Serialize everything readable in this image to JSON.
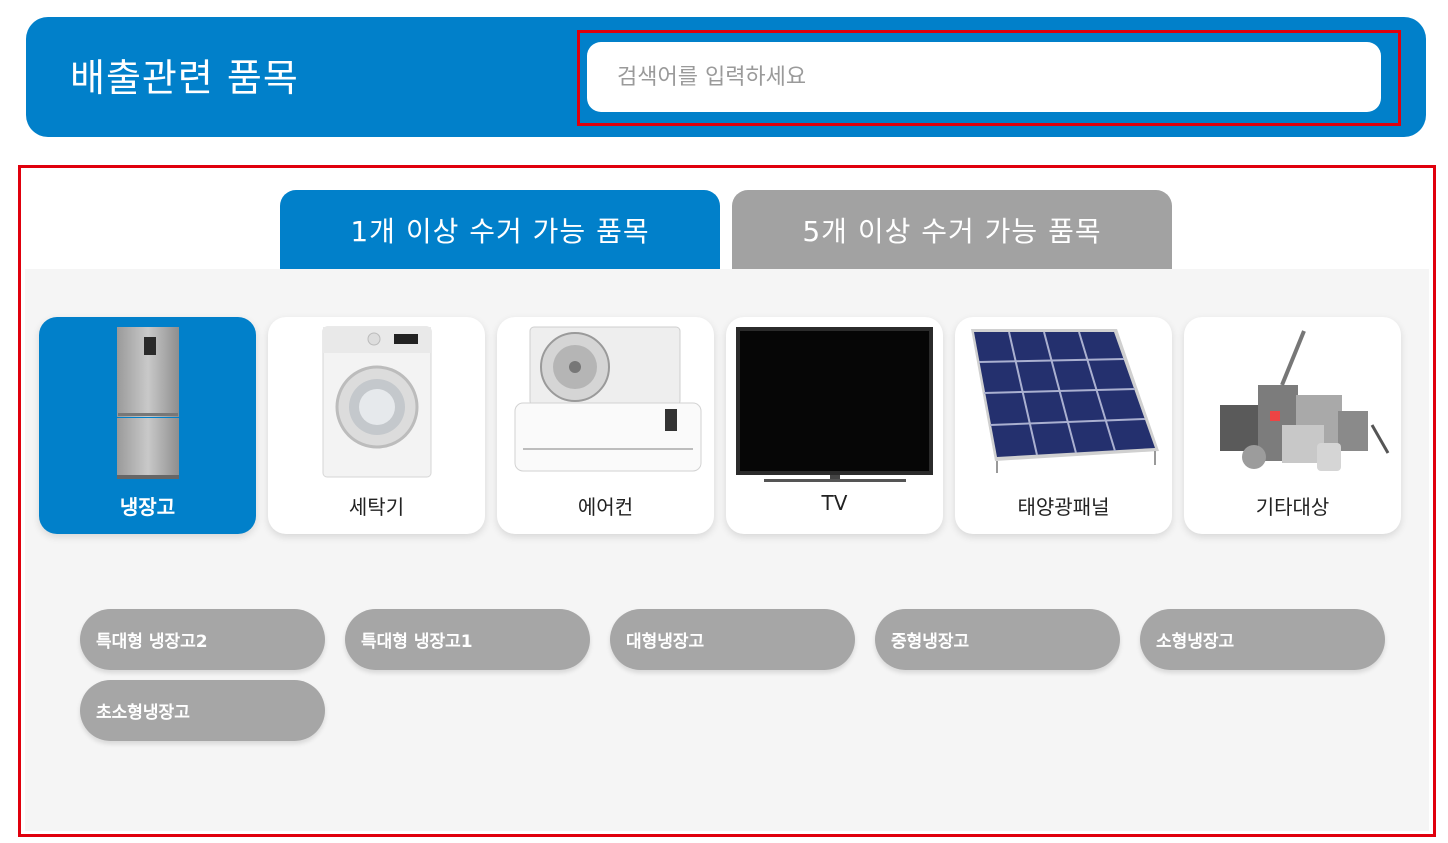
{
  "header": {
    "title": "배출관련 품목",
    "search_placeholder": "검색어를 입력하세요",
    "search_value": "",
    "bg_color": "#0180ca"
  },
  "tabs": [
    {
      "label": "1개 이상 수거 가능 품목",
      "active": true
    },
    {
      "label": "5개 이상 수거 가능 품목",
      "active": false
    }
  ],
  "categories": [
    {
      "label": "냉장고",
      "icon": "refrigerator-icon",
      "active": true
    },
    {
      "label": "세탁기",
      "icon": "washing-machine-icon",
      "active": false
    },
    {
      "label": "에어컨",
      "icon": "air-conditioner-icon",
      "active": false
    },
    {
      "label": "TV",
      "icon": "tv-icon",
      "active": false
    },
    {
      "label": "태양광패널",
      "icon": "solar-panel-icon",
      "active": false
    },
    {
      "label": "기타대상",
      "icon": "appliances-icon",
      "active": false
    }
  ],
  "subitems": [
    "특대형 냉장고2",
    "특대형 냉장고1",
    "대형냉장고",
    "중형냉장고",
    "소형냉장고",
    "초소형냉장고"
  ],
  "colors": {
    "accent": "#0180ca",
    "inactive": "#a2a2a2",
    "highlight": "#e0000d"
  }
}
